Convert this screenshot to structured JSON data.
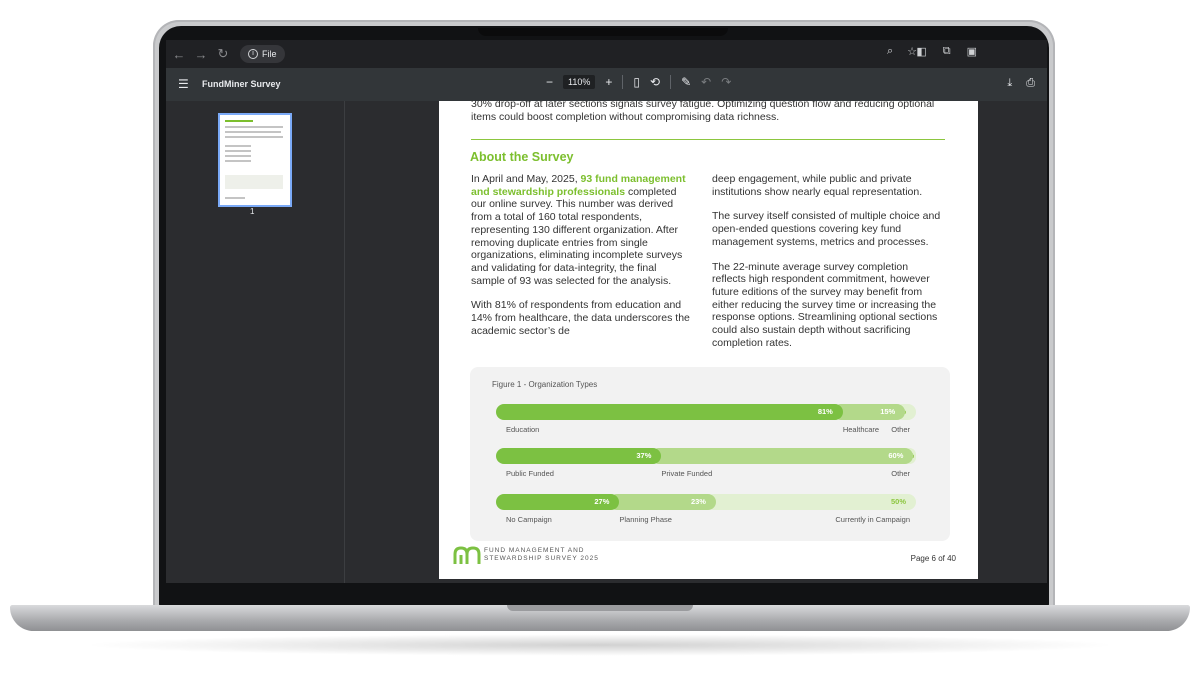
{
  "browser": {
    "address_label": "File",
    "nav": {
      "back": "←",
      "forward": "→",
      "reload": "↻"
    }
  },
  "toolbar": {
    "title": "FundMiner Survey",
    "zoom": "110%",
    "zoom_out": "−",
    "zoom_in": "+"
  },
  "sidebar": {
    "page_number": "1"
  },
  "doc": {
    "intro": "30% drop-off at later sections signals survey fatigue. Optimizing question flow and reducing optional items could boost completion without compromising data richness.",
    "heading": "About the Survey",
    "col1_p1_pre": "In April and May, 2025, ",
    "col1_p1_hl": "93 fund management and stewardship professionals",
    "col1_p1_post": " completed our online survey. This number was derived from a total of 160 total respondents, representing 130 different organization. After removing duplicate entries from single organizations, eliminating incomplete surveys and validating for data-integrity, the final sample of 93 was selected for the analysis.",
    "col1_p2": "With 81% of respondents from education and 14% from healthcare, the data underscores the academic sector’s de",
    "col2_p1": " deep engagement, while public and private institutions show nearly equal representation.",
    "col2_p2": "The survey itself consisted of multiple choice and open-ended questions covering key fund management systems, metrics and processes.",
    "col2_p3": "The 22-minute average survey completion reflects high respondent commitment, however future editions of the survey may benefit from either reducing the survey time or increasing the response options. Streamlining optional sections could also sustain depth without sacrificing completion rates.",
    "footer_line1": "FUND MANAGEMENT AND",
    "footer_line2": "STEWARDSHIP SURVEY 2025",
    "page_label": "Page 6 of 40"
  },
  "chart_data": {
    "type": "bar",
    "orientation": "horizontal-stacked",
    "title": "Figure 1 - Organization Types",
    "rows": [
      {
        "segments": [
          {
            "label": "Education",
            "value": 81,
            "value_label": "81%",
            "color": "#7cc142"
          },
          {
            "label": "Healthcare",
            "value": 15,
            "value_label": "15%",
            "color": "#b3d98a"
          },
          {
            "label": "Other",
            "value": 5,
            "value_label": "5%",
            "color": "#e2f0d2"
          }
        ]
      },
      {
        "segments": [
          {
            "label": "Public Funded",
            "value": 37,
            "value_label": "37%",
            "color": "#7cc142"
          },
          {
            "label": "Private Funded",
            "value": 60,
            "value_label": "60%",
            "color": "#b3d98a"
          },
          {
            "label": "Other",
            "value": 3,
            "value_label": "3%",
            "color": "#e2f0d2"
          }
        ]
      },
      {
        "segments": [
          {
            "label": "No Campaign",
            "value": 27,
            "value_label": "27%",
            "color": "#7cc142"
          },
          {
            "label": "Planning Phase",
            "value": 23,
            "value_label": "23%",
            "color": "#b3d98a"
          },
          {
            "label": "Currently in Campaign",
            "value": 50,
            "value_label": "50%",
            "color": "#e2f0d2"
          }
        ]
      }
    ]
  }
}
